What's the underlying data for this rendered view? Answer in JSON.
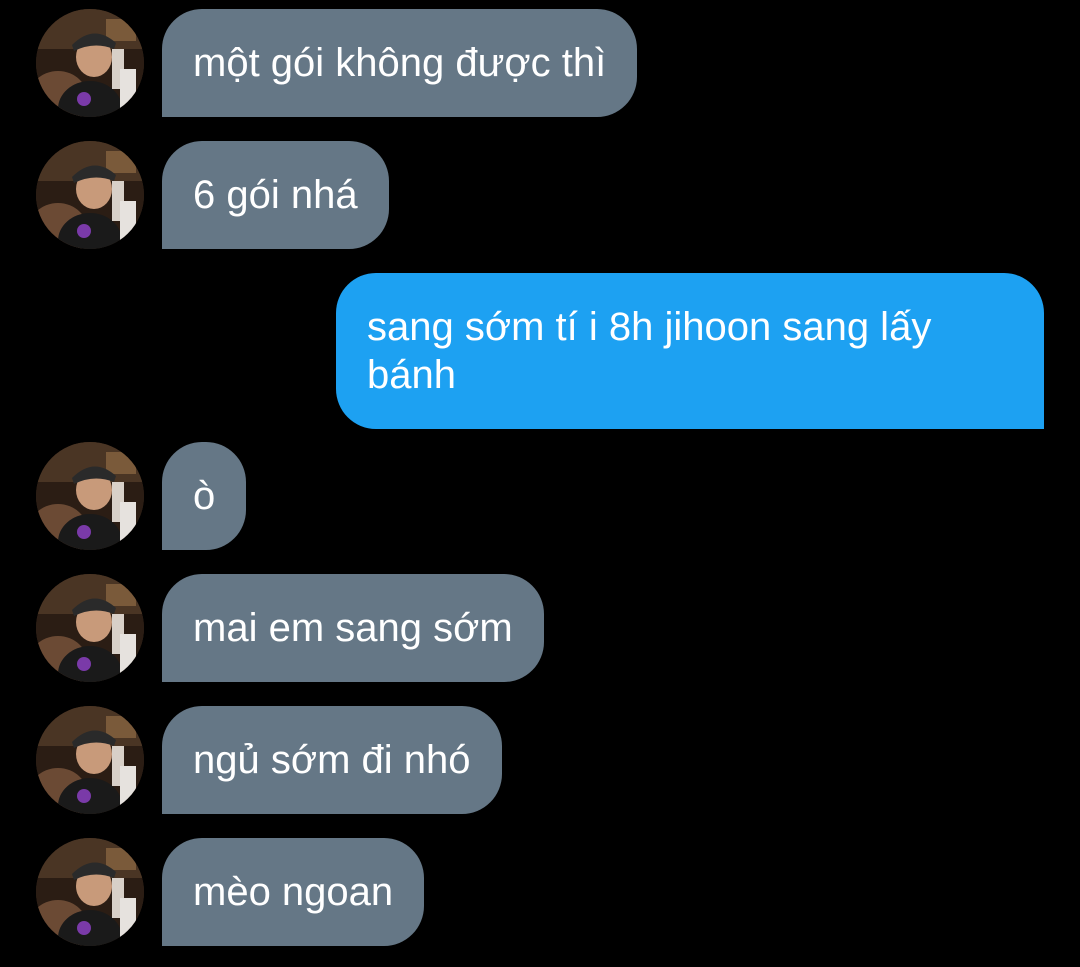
{
  "avatar_icon": "user-photo-avatar",
  "colors": {
    "background": "#000000",
    "incoming_bubble": "#657786",
    "outgoing_bubble": "#1da1f2",
    "text": "#ffffff"
  },
  "messages": [
    {
      "direction": "incoming",
      "text": "một gói không được thì"
    },
    {
      "direction": "incoming",
      "text": "6 gói nhá"
    },
    {
      "direction": "outgoing",
      "text": "sang sớm tí i 8h jihoon sang lấy bánh"
    },
    {
      "direction": "incoming",
      "text": "ò"
    },
    {
      "direction": "incoming",
      "text": "mai em sang sớm"
    },
    {
      "direction": "incoming",
      "text": "ngủ sớm đi nhó"
    },
    {
      "direction": "incoming",
      "text": "mèo ngoan"
    }
  ]
}
